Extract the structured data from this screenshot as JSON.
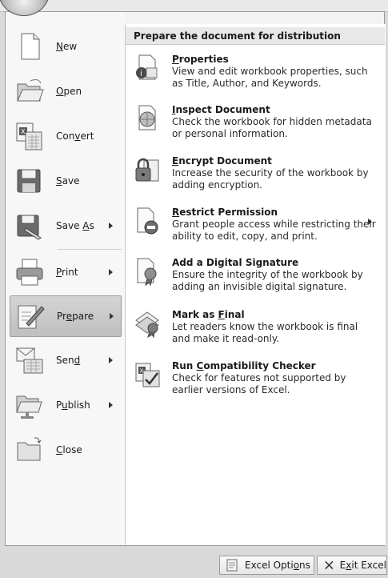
{
  "office_button": {
    "icon": "office-orb-icon"
  },
  "left_menu": {
    "items": [
      {
        "label": "New",
        "mnemonic_index": 0,
        "has_submenu": false,
        "icon": "new-document-icon"
      },
      {
        "label": "Open",
        "mnemonic_index": 0,
        "has_submenu": false,
        "icon": "open-folder-icon"
      },
      {
        "label": "Convert",
        "mnemonic_index": 3,
        "has_submenu": false,
        "icon": "convert-icon"
      },
      {
        "label": "Save",
        "mnemonic_index": 0,
        "has_submenu": false,
        "icon": "save-floppy-icon"
      },
      {
        "label": "Save As",
        "mnemonic_index": 5,
        "has_submenu": true,
        "icon": "save-as-icon"
      },
      {
        "label": "Print",
        "mnemonic_index": 0,
        "has_submenu": true,
        "icon": "printer-icon"
      },
      {
        "label": "Prepare",
        "mnemonic_index": 2,
        "has_submenu": true,
        "icon": "prepare-pen-icon",
        "selected": true
      },
      {
        "label": "Send",
        "mnemonic_index": 3,
        "has_submenu": true,
        "icon": "send-mail-icon"
      },
      {
        "label": "Publish",
        "mnemonic_index": 1,
        "has_submenu": true,
        "icon": "publish-icon"
      },
      {
        "label": "Close",
        "mnemonic_index": 0,
        "has_submenu": false,
        "icon": "close-folder-icon"
      }
    ]
  },
  "prepare_panel": {
    "header": "Prepare the document for distribution",
    "items": [
      {
        "title": "Properties",
        "mnemonic_index": 0,
        "description": "View and edit workbook properties, such as Title, Author, and Keywords.",
        "icon": "properties-icon",
        "has_submenu": false
      },
      {
        "title": "Inspect Document",
        "mnemonic_index": 0,
        "description": "Check the workbook for hidden metadata or personal information.",
        "icon": "inspect-document-icon",
        "has_submenu": false
      },
      {
        "title": "Encrypt Document",
        "mnemonic_index": 0,
        "description": "Increase the security of the workbook by adding encryption.",
        "icon": "encrypt-lock-icon",
        "has_submenu": false
      },
      {
        "title": "Restrict Permission",
        "mnemonic_index": 0,
        "description": "Grant people access while restricting their ability to edit, copy, and print.",
        "icon": "restrict-permission-icon",
        "has_submenu": true
      },
      {
        "title": "Add a Digital Signature",
        "mnemonic_index": 16,
        "description": "Ensure the integrity of the workbook by adding an invisible digital signature.",
        "icon": "digital-signature-icon",
        "has_submenu": false
      },
      {
        "title": "Mark as Final",
        "mnemonic_index": 8,
        "description": "Let readers know the workbook is final and make it read-only.",
        "icon": "mark-final-icon",
        "has_submenu": false
      },
      {
        "title": "Run Compatibility Checker",
        "mnemonic_index": 4,
        "description": "Check for features not supported by earlier versions of Excel.",
        "icon": "compatibility-checker-icon",
        "has_submenu": false
      }
    ]
  },
  "footer": {
    "options_label": "Excel Options",
    "options_mnemonic_index": 10,
    "exit_label": "Exit Excel",
    "exit_mnemonic_index": 1
  }
}
